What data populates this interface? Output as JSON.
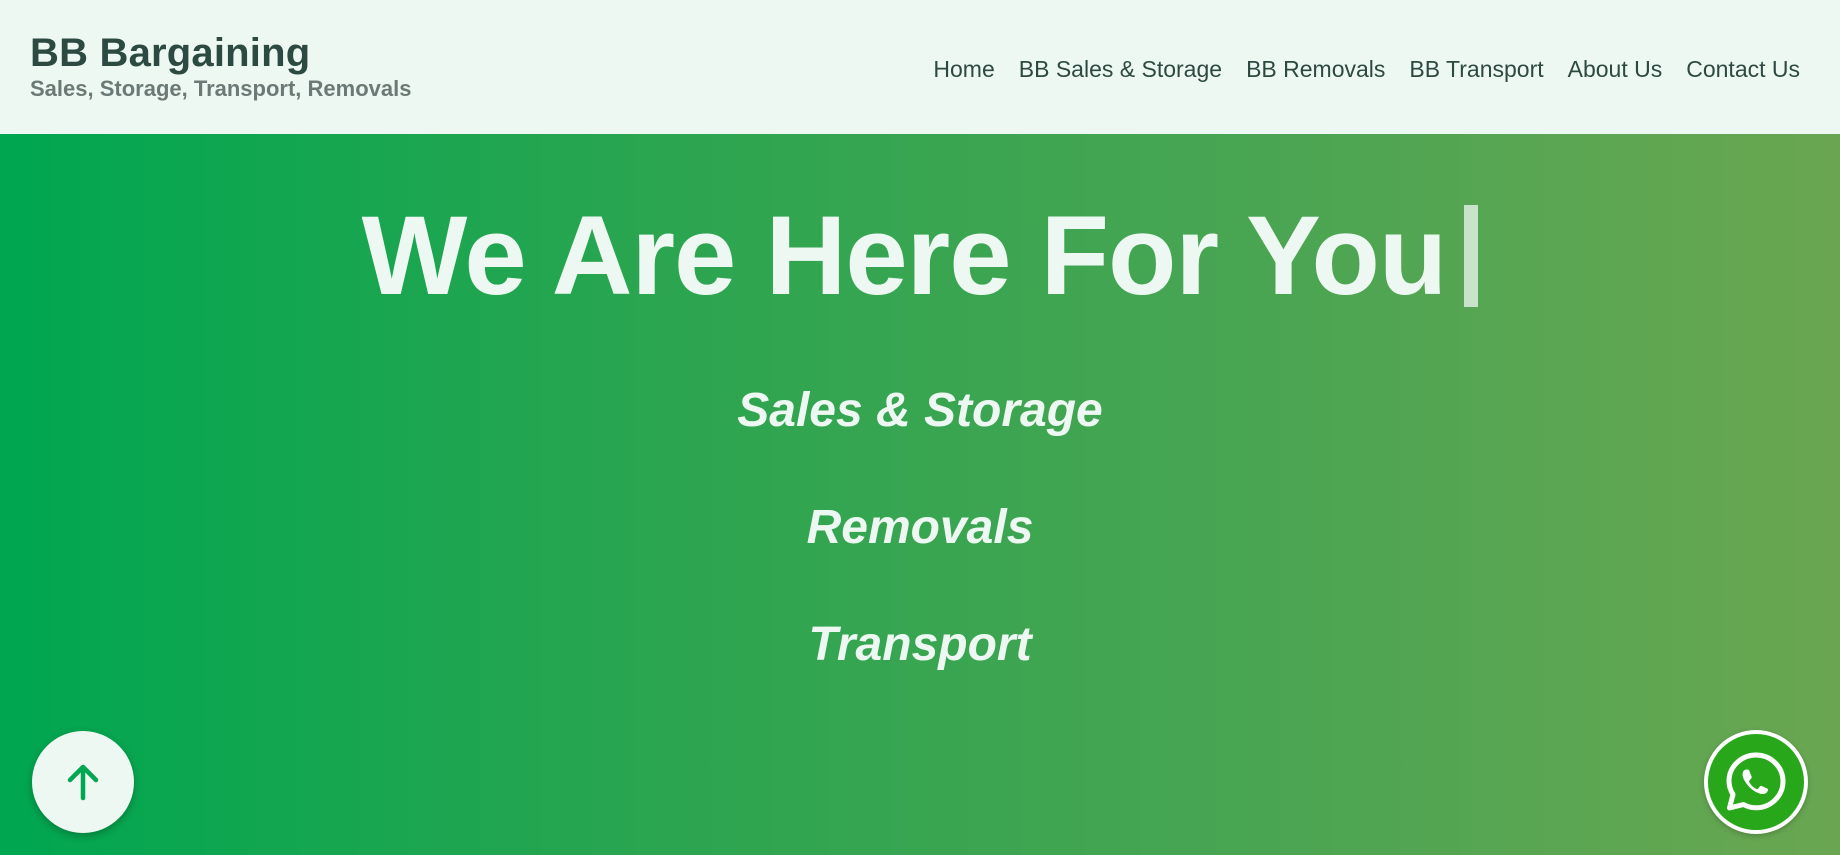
{
  "header": {
    "brand_title": "BB Bargaining",
    "brand_tagline": "Sales, Storage, Transport, Removals",
    "nav": [
      {
        "label": "Home"
      },
      {
        "label": "BB Sales & Storage"
      },
      {
        "label": "BB Removals"
      },
      {
        "label": "BB Transport"
      },
      {
        "label": "About Us"
      },
      {
        "label": "Contact Us"
      }
    ]
  },
  "hero": {
    "headline": "We Are Here For You",
    "services": [
      "Sales & Storage",
      "Removals",
      "Transport"
    ]
  },
  "icons": {
    "scroll_top": "arrow-up-icon",
    "chat": "whatsapp-icon"
  },
  "colors": {
    "header_bg": "#eef8f2",
    "hero_gradient_start": "#00a650",
    "hero_gradient_end": "#6aa651",
    "text_dark": "#2c4a42",
    "text_light": "#eef8f2",
    "whatsapp_green": "#29a71a"
  }
}
